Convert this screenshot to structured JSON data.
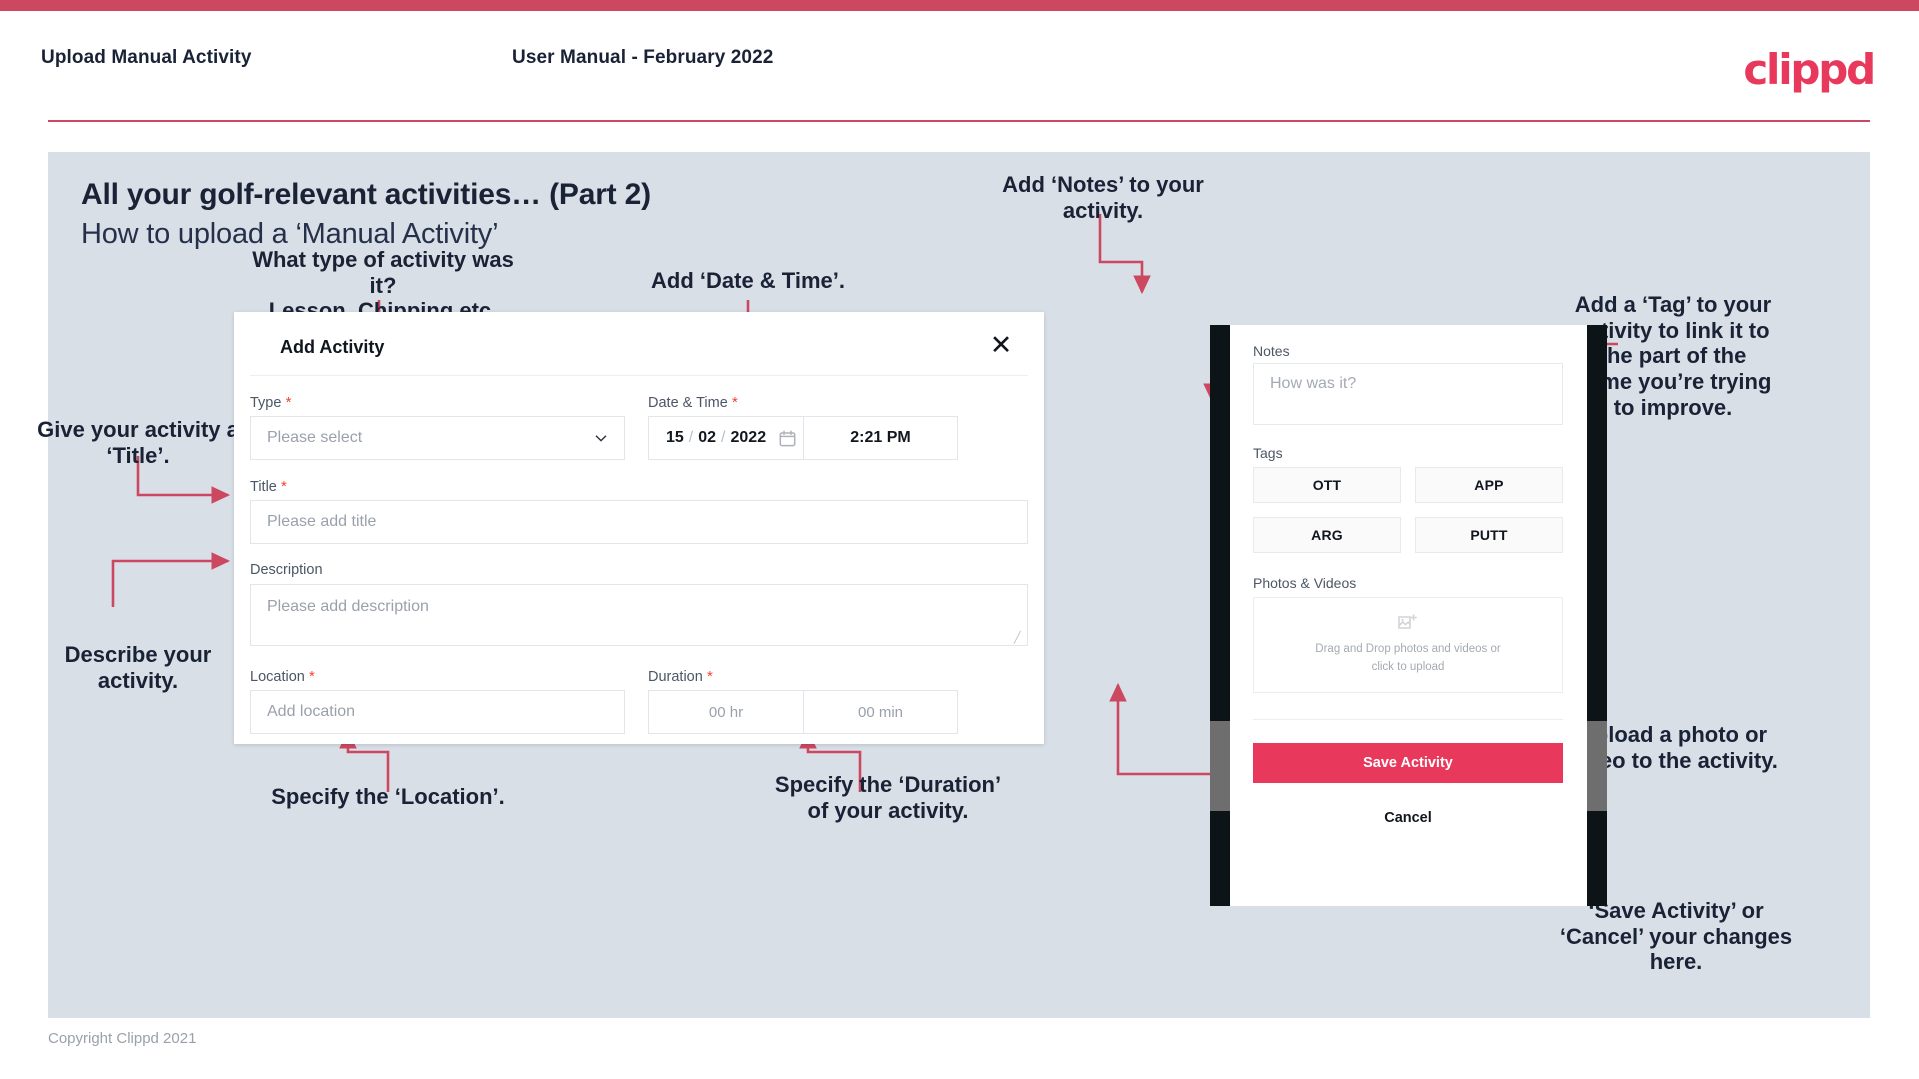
{
  "header": {
    "title": "Upload Manual Activity",
    "subtitle": "User Manual - February 2022",
    "logo": "clippd"
  },
  "slide": {
    "title": "All your golf-relevant activities… (Part 2)",
    "subtitle": "How to upload a ‘Manual Activity’"
  },
  "annotations": {
    "type": "What type of activity was it?\nLesson, Chipping etc.",
    "datetime": "Add ‘Date & Time’.",
    "title": "Give your activity a\n‘Title’.",
    "description": "Describe your\nactivity.",
    "location": "Specify the ‘Location’.",
    "duration": "Specify the ‘Duration’\nof your activity.",
    "notes": "Add ‘Notes’ to your\nactivity.",
    "tags": "Add a ‘Tag’ to your\nactivity to link it to\nthe part of the\ngame you’re trying\nto improve.",
    "photos": "Upload a photo or\nvideo to the activity.",
    "save": "‘Save Activity’ or\n‘Cancel’ your changes\nhere."
  },
  "dialog": {
    "title": "Add Activity",
    "close_icon": "close-icon",
    "fields": {
      "type": {
        "label": "Type",
        "required": true,
        "placeholder": "Please select"
      },
      "datetime": {
        "label": "Date & Time",
        "required": true,
        "day": "15",
        "month": "02",
        "year": "2022",
        "separator": "/",
        "time": "2:21 PM",
        "calendar_icon": "calendar-icon"
      },
      "title": {
        "label": "Title",
        "required": true,
        "placeholder": "Please add title"
      },
      "description": {
        "label": "Description",
        "required": false,
        "placeholder": "Please add description"
      },
      "location": {
        "label": "Location",
        "required": true,
        "placeholder": "Add location"
      },
      "duration": {
        "label": "Duration",
        "required": true,
        "hours": "00 hr",
        "minutes": "00 min"
      }
    }
  },
  "phone": {
    "notes": {
      "label": "Notes",
      "placeholder": "How was it?"
    },
    "tags": {
      "label": "Tags",
      "options": [
        "OTT",
        "APP",
        "ARG",
        "PUTT"
      ]
    },
    "photos": {
      "label": "Photos & Videos",
      "dropzone_line1": "Drag and Drop photos and videos or",
      "dropzone_line2": "click to upload",
      "icon": "add-image-icon"
    },
    "save_label": "Save Activity",
    "cancel_label": "Cancel"
  },
  "footer": {
    "copyright": "Copyright Clippd 2021"
  },
  "colors": {
    "brand_pink": "#e8395c",
    "top_bar": "#cc4861",
    "arrow": "#cc4861",
    "slide_bg": "#d9dfe7",
    "text_dark": "#1a2236"
  }
}
